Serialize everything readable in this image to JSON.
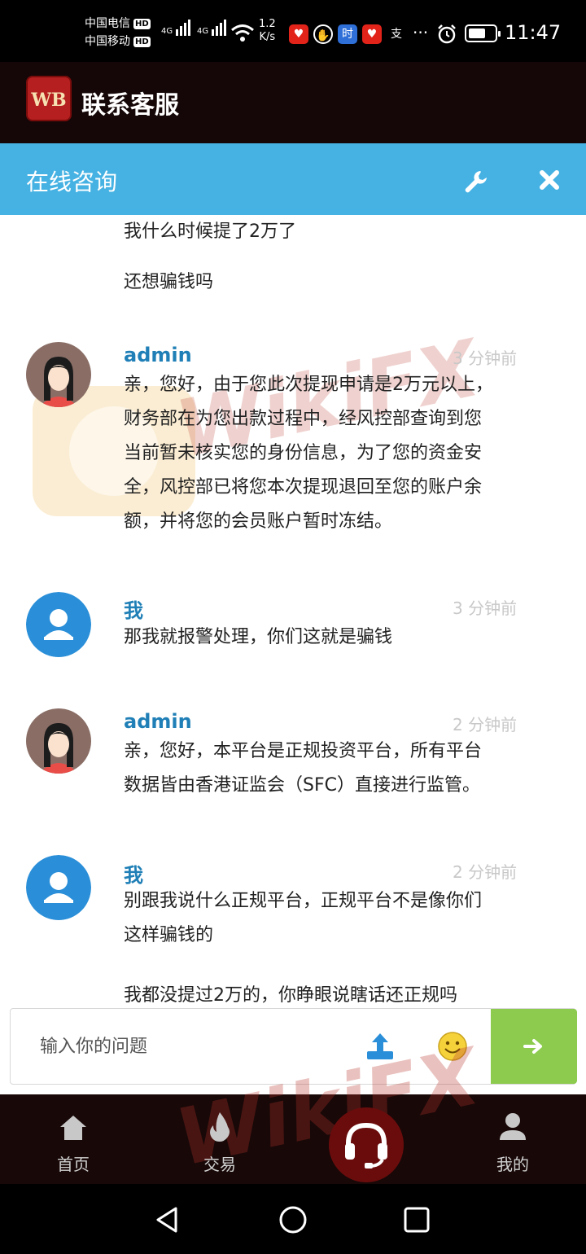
{
  "status_bar": {
    "carrier1": "中国电信",
    "carrier2": "中国移动",
    "hd": "HD",
    "net_type": "4G",
    "net_speed_value": "1.2",
    "net_speed_unit": "K/s",
    "more": "···",
    "time": "11:47"
  },
  "app_header": {
    "logo": "WB",
    "title": "联系客服"
  },
  "chat_header": {
    "title": "在线咨询"
  },
  "messages": [
    {
      "text": "我什么时候提了2万了"
    },
    {
      "text": "还想骗钱吗"
    },
    {
      "sender": "admin",
      "time": "3 分钟前",
      "lines": [
        "亲，您好，由于您此次提现申请是2万元以上，",
        "财务部在为您出款过程中，经风控部查询到您",
        "当前暂未核实您的身份信息，为了您的资金安",
        "全，风控部已将您本次提现退回至您的账户余",
        "额，并将您的会员账户暂时冻结。"
      ]
    },
    {
      "sender": "我",
      "time": "3 分钟前",
      "lines": [
        "那我就报警处理，你们这就是骗钱"
      ]
    },
    {
      "sender": "admin",
      "time": "2 分钟前",
      "lines": [
        "亲，您好，本平台是正规投资平台，所有平台",
        "数据皆由香港证监会（SFC）直接进行监管。"
      ]
    },
    {
      "sender": "我",
      "time": "2 分钟前",
      "lines": [
        "别跟我说什么正规平台，正规平台不是像你们",
        "这样骗钱的"
      ]
    },
    {
      "text": "我都没提过2万的，你睁眼说瞎话还正规吗"
    }
  ],
  "input": {
    "placeholder": "输入你的问题",
    "value": "",
    "send_icon": "arrow-right-icon"
  },
  "bottom_nav": {
    "items": [
      {
        "label": "首页",
        "icon": "home-icon"
      },
      {
        "label": "交易",
        "icon": "flame-icon"
      },
      {
        "label": "",
        "icon": "headset-icon"
      },
      {
        "label": "我的",
        "icon": "person-icon"
      }
    ]
  },
  "watermark": "WikiFX",
  "colors": {
    "header_bg": "#150707",
    "chat_header_bg": "#45b2e3",
    "sender_name": "#1f7fb6",
    "send_button": "#8ccb4d",
    "nav_bg": "#180808",
    "center_button": "#6b0c0c"
  }
}
